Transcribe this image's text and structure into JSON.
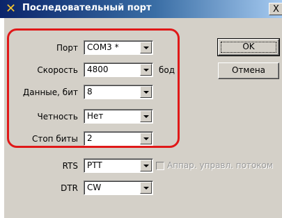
{
  "window": {
    "title": "Последовательный порт",
    "close_label": "X"
  },
  "fields": [
    {
      "label": "Порт",
      "value": "COM3 *"
    },
    {
      "label": "Скорость",
      "value": "4800"
    },
    {
      "label": "Данные, бит",
      "value": "8"
    },
    {
      "label": "Четность",
      "value": "Нет"
    },
    {
      "label": "Стоп биты",
      "value": "2"
    },
    {
      "label": "RTS",
      "value": "PTT"
    },
    {
      "label": "DTR",
      "value": "CW"
    }
  ],
  "speed_unit": "бод",
  "buttons": {
    "ok": "OK",
    "cancel": "Отмена"
  },
  "flow_control": {
    "label": "Аппар. управл. потоком",
    "checked": false,
    "enabled": false
  },
  "colors": {
    "highlight": "#e01818",
    "title_bar": "#0a246a",
    "dialog_bg": "#d4d0c8"
  }
}
